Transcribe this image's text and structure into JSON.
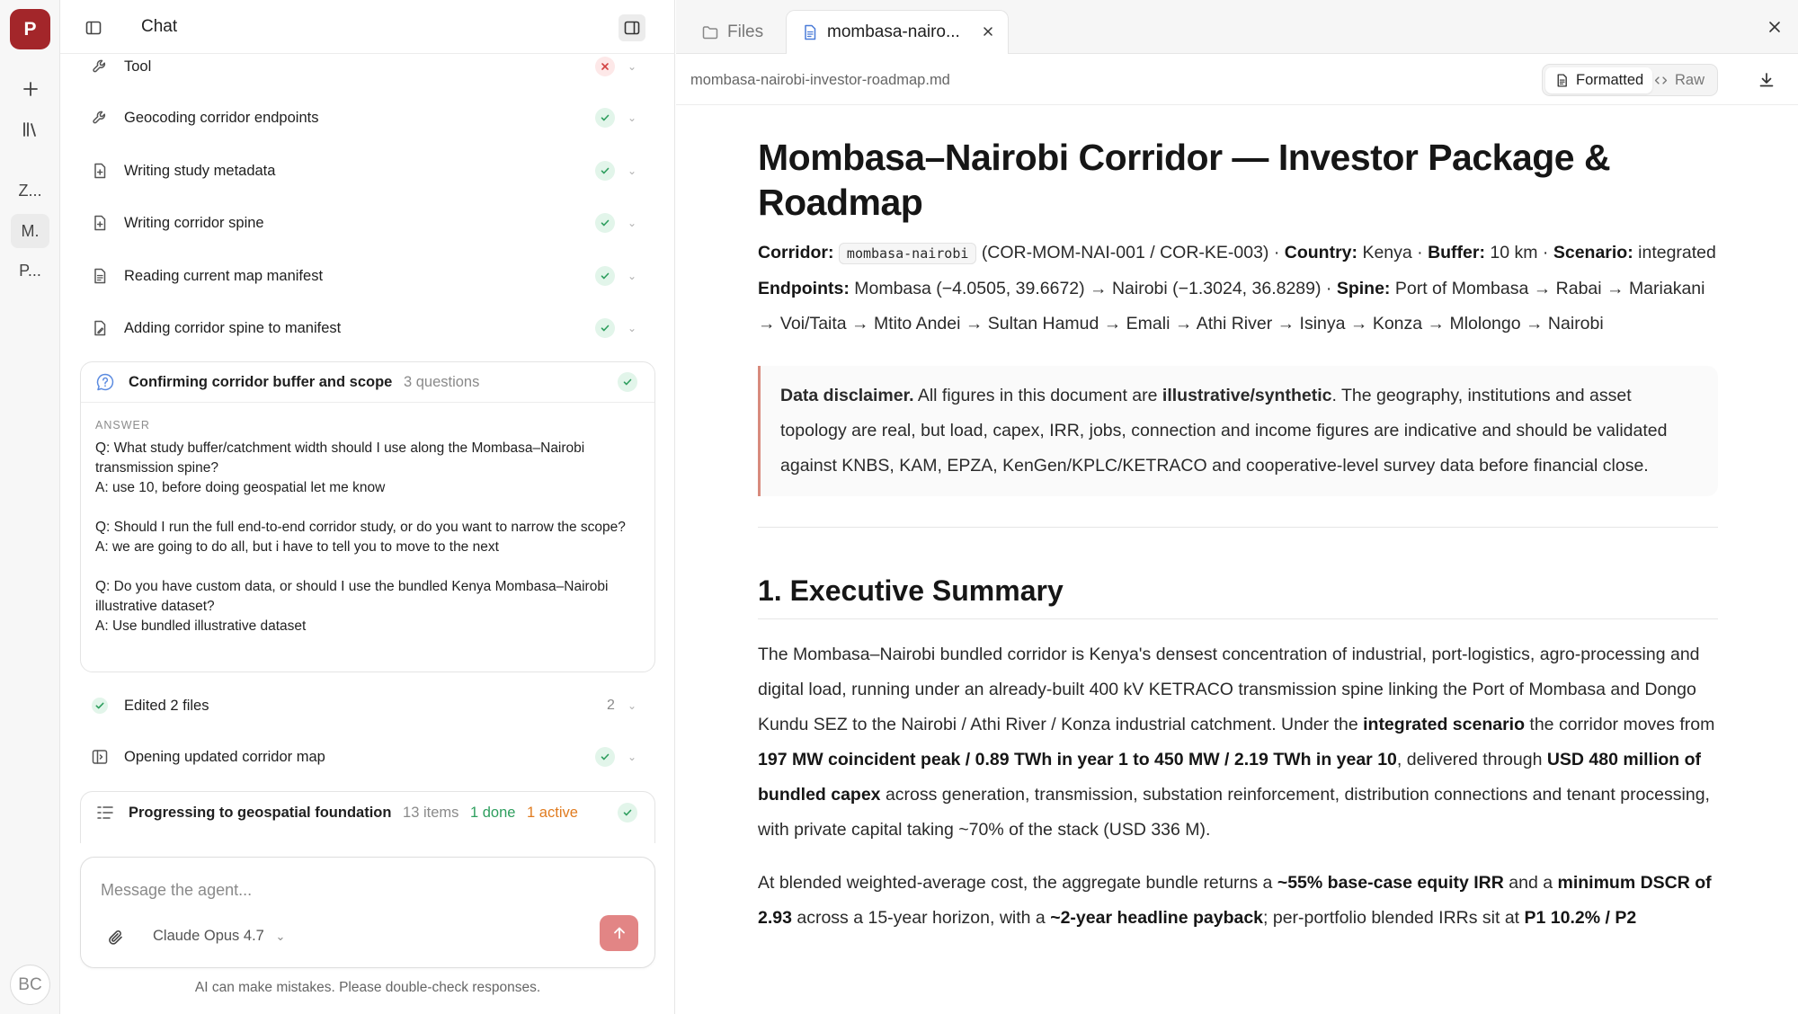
{
  "rail": {
    "avatar_initial": "P",
    "items": [
      "Z...",
      "M.",
      "P..."
    ],
    "user_initials": "BC"
  },
  "chat": {
    "title": "Chat",
    "steps": [
      {
        "label": "Tool",
        "status": "error"
      },
      {
        "label": "Geocoding corridor endpoints",
        "status": "done"
      },
      {
        "label": "Writing study metadata",
        "status": "done"
      },
      {
        "label": "Writing corridor spine",
        "status": "done"
      },
      {
        "label": "Reading current map manifest",
        "status": "done"
      },
      {
        "label": "Adding corridor spine to manifest",
        "status": "done"
      }
    ],
    "questions_card": {
      "title": "Confirming corridor buffer and scope",
      "count": "3 questions",
      "answer_label": "ANSWER",
      "qa": [
        {
          "q": "Q: What study buffer/catchment width should I use along the Mombasa–Nairobi transmission spine?",
          "a": "A: use 10, before doing geospatial let me know"
        },
        {
          "q": "Q: Should I run the full end-to-end corridor study, or do you want to narrow the scope?",
          "a": "A: we are going to do all, but i have to tell you to move to the next"
        },
        {
          "q": "Q: Do you have custom data, or should I use the bundled Kenya Mombasa–Nairobi illustrative dataset?",
          "a": "A: Use bundled illustrative dataset"
        }
      ]
    },
    "edited": {
      "label": "Edited 2 files",
      "count": "2"
    },
    "opening": {
      "label": "Opening updated corridor map"
    },
    "progress": {
      "label": "Progressing to geospatial foundation",
      "items": "13 items",
      "done": "1 done",
      "active": "1 active"
    },
    "composer": {
      "placeholder": "Message the agent...",
      "model": "Claude Opus 4.7"
    },
    "disclaimer": "AI can make mistakes. Please double-check responses."
  },
  "doc": {
    "tabs": {
      "files": "Files",
      "active": "mombasa-nairo..."
    },
    "filepath": "mombasa-nairobi-investor-roadmap.md",
    "view_modes": {
      "formatted": "Formatted",
      "raw": "Raw"
    },
    "title": "Mombasa–Nairobi Corridor — Investor Package & Roadmap",
    "meta": {
      "corridor_label": "Corridor:",
      "corridor_code": "mombasa-nairobi",
      "corridor_ids": "(COR-MOM-NAI-001 / COR-KE-003) ·",
      "country_label": "Country:",
      "country": "Kenya ·",
      "buffer_label": "Buffer:",
      "buffer": "10 km ·",
      "scenario_label": "Scenario:",
      "scenario": "integrated",
      "endpoints_label": "Endpoints:",
      "endpoints": "Mombasa (−4.0505, 39.6672) → Nairobi (−1.3024, 36.8289) ·",
      "spine_label": "Spine:",
      "spine": "Port of Mombasa → Rabai → Mariakani → Voi/Taita → Mtito Andei → Sultan Hamud → Emali → Athi River → Isinya → Konza → Mlolongo → Nairobi"
    },
    "callout": {
      "lead": "Data disclaimer.",
      "t1": "All figures in this document are",
      "bold": "illustrative/synthetic",
      "t2": ". The geography, institutions and asset topology are real, but load, capex, IRR, jobs, connection and income figures are indicative and should be validated against KNBS, KAM, EPZA, KenGen/KPLC/KETRACO and cooperative-level survey data before financial close."
    },
    "section1": {
      "heading": "1. Executive Summary",
      "p1": {
        "t1": "The Mombasa–Nairobi bundled corridor is Kenya's densest concentration of industrial, port-logistics, agro-processing and digital load, running under an already-built 400 kV KETRACO transmission spine linking the Port of Mombasa and Dongo Kundu SEZ to the Nairobi / Athi River / Konza industrial catchment. Under the",
        "b1": "integrated scenario",
        "t2": "the corridor moves from",
        "b2": "197 MW coincident peak / 0.89 TWh in year 1 to 450 MW / 2.19 TWh in year 10",
        "t3": ", delivered through",
        "b3": "USD 480 million of bundled capex",
        "t4": "across generation, transmission, substation reinforcement, distribution connections and tenant processing, with private capital taking ~70% of the stack (USD 336 M)."
      },
      "p2": {
        "t1": "At blended weighted-average cost, the aggregate bundle returns a",
        "b1": "~55% base-case equity IRR",
        "t2": "and a",
        "b2": "minimum DSCR of 2.93",
        "t3": "across a 15-year horizon, with a",
        "b3": "~2-year headline payback",
        "t4": "; per-portfolio blended IRRs sit at",
        "b4": "P1 10.2% / P2"
      }
    }
  }
}
